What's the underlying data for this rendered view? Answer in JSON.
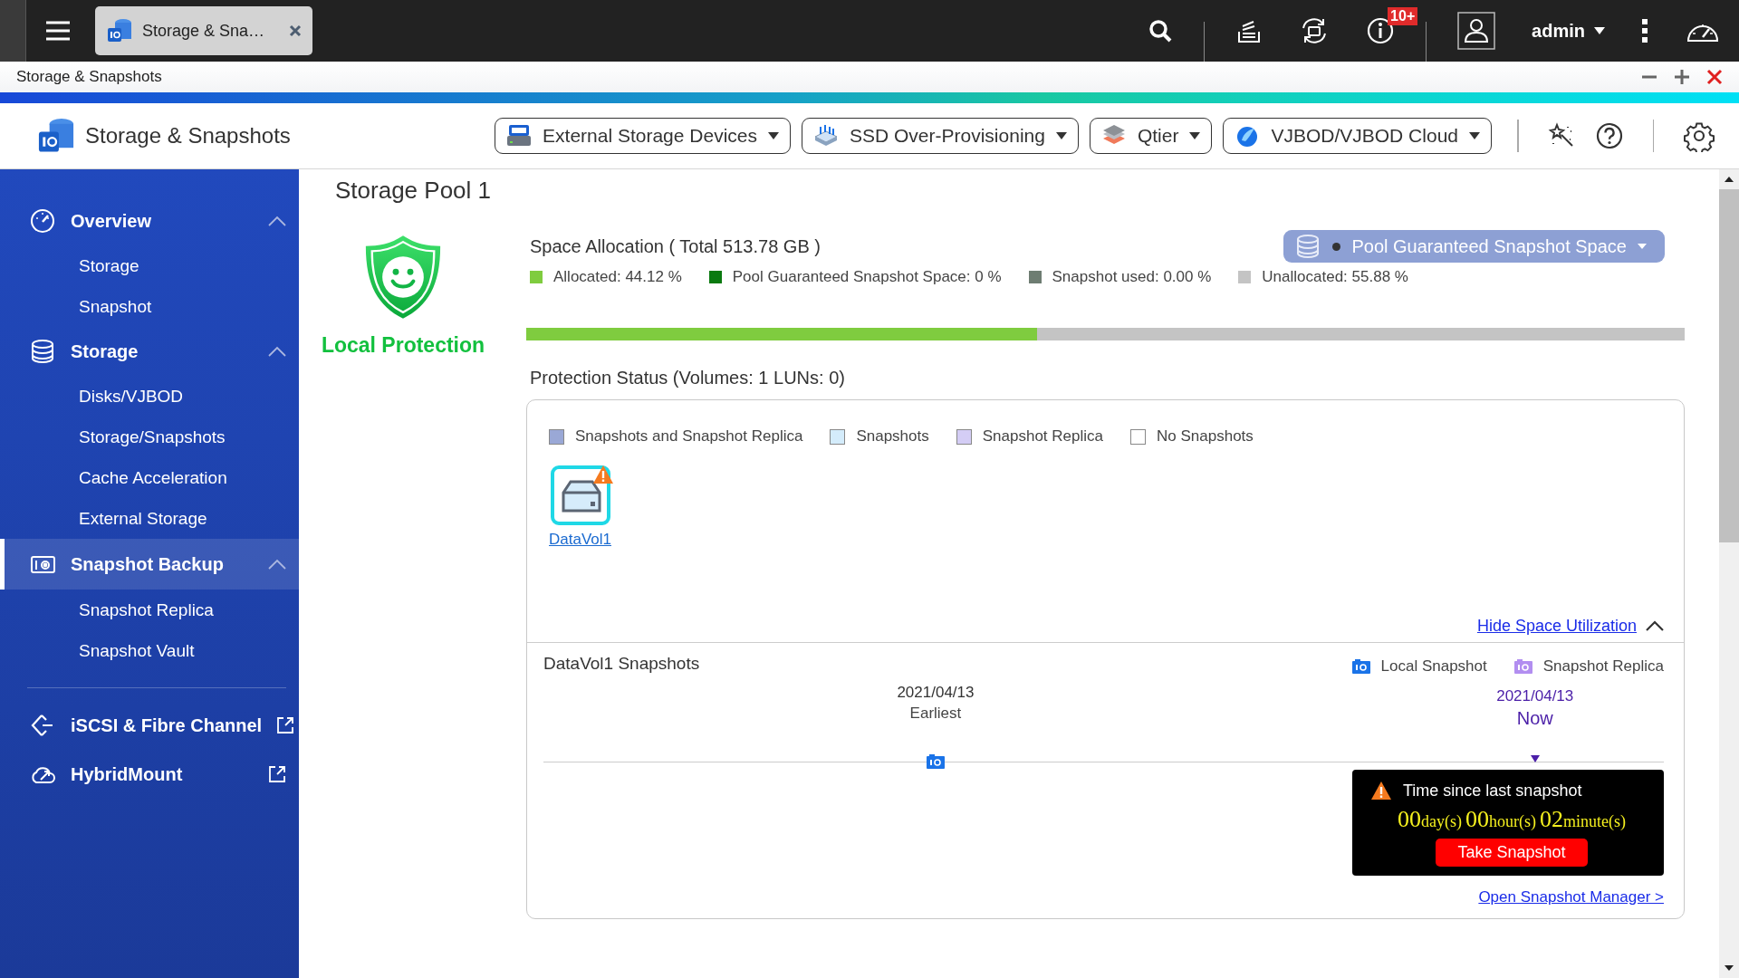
{
  "topbar": {
    "tab": {
      "title": "Storage & Sna…",
      "selected": true
    },
    "badge": "10+",
    "user": "admin"
  },
  "window": {
    "title": "Storage & Snapshots"
  },
  "header": {
    "app_title": "Storage & Snapshots",
    "dropdowns": [
      {
        "label": "External Storage Devices",
        "kind": "raid"
      },
      {
        "label": "SSD Over-Provisioning",
        "kind": "ssd"
      },
      {
        "label": "Qtier",
        "kind": "qtier"
      },
      {
        "label": "VJBOD/VJBOD Cloud",
        "kind": "cloud"
      }
    ]
  },
  "sidebar": {
    "sections": [
      {
        "label": "Overview",
        "kind": "gauge",
        "expanded": true,
        "selected": false,
        "external": false,
        "children": [
          {
            "label": "Storage"
          },
          {
            "label": "Snapshot"
          }
        ]
      },
      {
        "label": "Storage",
        "kind": "database",
        "expanded": true,
        "selected": false,
        "external": false,
        "children": [
          {
            "label": "Disks/VJBOD"
          },
          {
            "label": "Storage/Snapshots"
          },
          {
            "label": "Cache Acceleration"
          },
          {
            "label": "External Storage"
          }
        ]
      },
      {
        "label": "Snapshot Backup",
        "kind": "camera",
        "expanded": true,
        "selected": true,
        "external": false,
        "children": [
          {
            "label": "Snapshot Replica"
          },
          {
            "label": "Snapshot Vault"
          }
        ]
      },
      {
        "label": "iSCSI & Fibre Channel",
        "kind": "diamond",
        "expanded": false,
        "selected": false,
        "external": true,
        "divider_before": true
      },
      {
        "label": "HybridMount",
        "kind": "cloud",
        "expanded": false,
        "selected": false,
        "external": true
      }
    ]
  },
  "pool": {
    "title": "Storage Pool 1",
    "status": "Local Protection"
  },
  "allocation": {
    "title": "Space Allocation ( Total 513.78 GB )",
    "selector": "Pool Guaranteed Snapshot Space",
    "legend": [
      {
        "label": "Allocated: 44.12 %",
        "color": "#7fcc3f"
      },
      {
        "label": "Pool Guaranteed Snapshot Space: 0 %",
        "color": "#0a7a10"
      },
      {
        "label": "Snapshot used: 0.00 %",
        "color": "#6e7d72"
      },
      {
        "label": "Unallocated: 55.88 %",
        "color": "#c4c4c4"
      }
    ],
    "bar": [
      {
        "level": 0.4412,
        "color": "#7fcc3f"
      },
      {
        "level": 0.5588,
        "color": "#c4c4c4"
      }
    ]
  },
  "protection": {
    "title": "Protection Status (Volumes: 1 LUNs: 0)",
    "legend": [
      {
        "label": "Snapshots and Snapshot Replica",
        "color": "#9aa8d6"
      },
      {
        "label": "Snapshots",
        "color": "#d4ecfb"
      },
      {
        "label": "Snapshot Replica",
        "color": "#d4cdf5"
      },
      {
        "label": "No Snapshots",
        "color": "#ffffff"
      }
    ],
    "volumes": [
      {
        "name": "DataVol1",
        "warning": true
      }
    ],
    "toggle": "Hide Space Utilization"
  },
  "snapshots": {
    "title": "DataVol1 Snapshots",
    "legend": [
      {
        "label": "Local Snapshot",
        "color": "#1a73e8"
      },
      {
        "label": "Snapshot Replica",
        "color": "#b28ef0"
      }
    ],
    "earliest": {
      "date": "2021/04/13",
      "label": "Earliest"
    },
    "now": {
      "date": "2021/04/13",
      "label": "Now"
    },
    "popup": {
      "title": "Time since last snapshot",
      "parts": [
        {
          "value": "00",
          "unit": "day(s)"
        },
        {
          "value": "00",
          "unit": "hour(s)"
        },
        {
          "value": "02",
          "unit": "minute(s)"
        }
      ],
      "button": "Take Snapshot"
    },
    "link": "Open Snapshot Manager >"
  }
}
